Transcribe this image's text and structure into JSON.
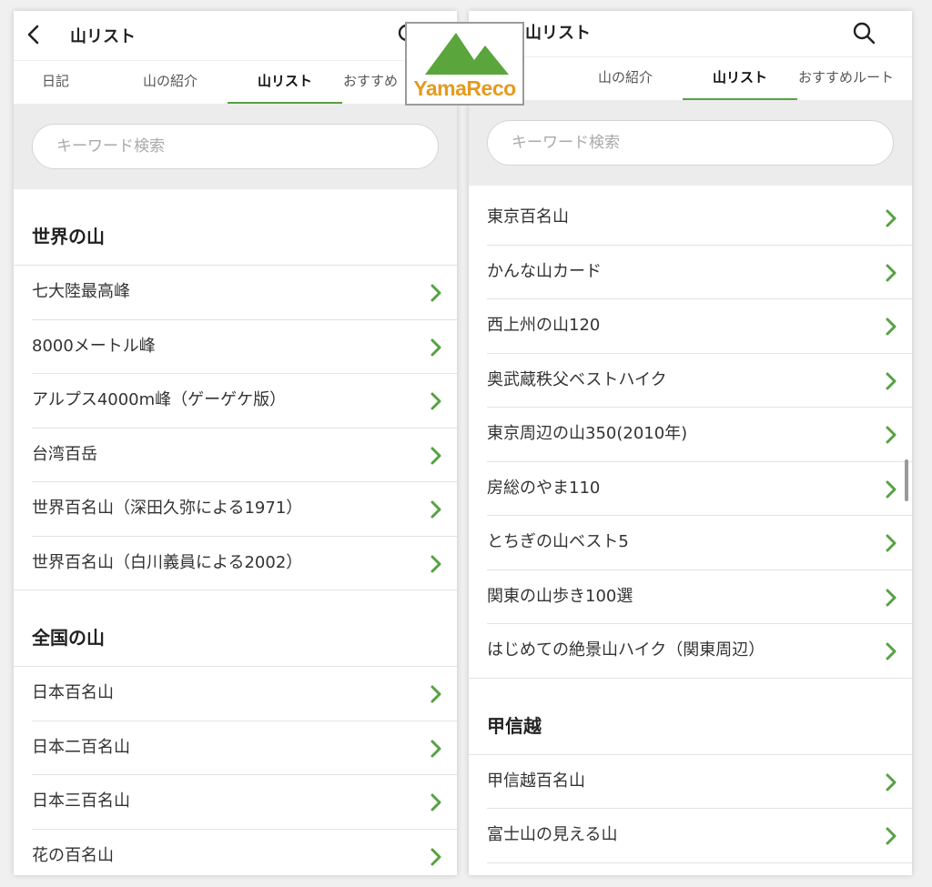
{
  "left": {
    "title": "山リスト",
    "tabs": [
      "日記",
      "山の紹介",
      "山リスト",
      "おすすめ"
    ],
    "search_placeholder": "キーワード検索",
    "sections": [
      {
        "heading": "世界の山",
        "items": [
          "七大陸最高峰",
          "8000メートル峰",
          "アルプス4000m峰（ゲーゲケ版）",
          "台湾百岳",
          "世界百名山（深田久弥による1971）",
          "世界百名山（白川義員による2002）"
        ]
      },
      {
        "heading": "全国の山",
        "items": [
          "日本百名山",
          "日本二百名山",
          "日本三百名山",
          "花の百名山"
        ]
      }
    ]
  },
  "right": {
    "title": "山リスト",
    "tabs": [
      "山の紹介",
      "山リスト",
      "おすすめルート"
    ],
    "search_placeholder": "キーワード検索",
    "items_top": [
      "東京百名山",
      "かんな山カード",
      "西上州の山120",
      "奥武蔵秩父ベストハイク",
      "東京周辺の山350(2010年)",
      "房総のやま110",
      "とちぎの山ベスト5",
      "関東の山歩き100選",
      "はじめての絶景山ハイク（関東周辺）"
    ],
    "section": {
      "heading": "甲信越",
      "items": [
        "甲信越百名山",
        "富士山の見える山"
      ]
    }
  },
  "logo": {
    "text": "YamaReco"
  },
  "colors": {
    "accent": "#57a143",
    "logo_text": "#e59a1e"
  },
  "icons": {
    "back": "chevron-left-icon",
    "search": "search-icon",
    "row": "chevron-right-icon"
  }
}
